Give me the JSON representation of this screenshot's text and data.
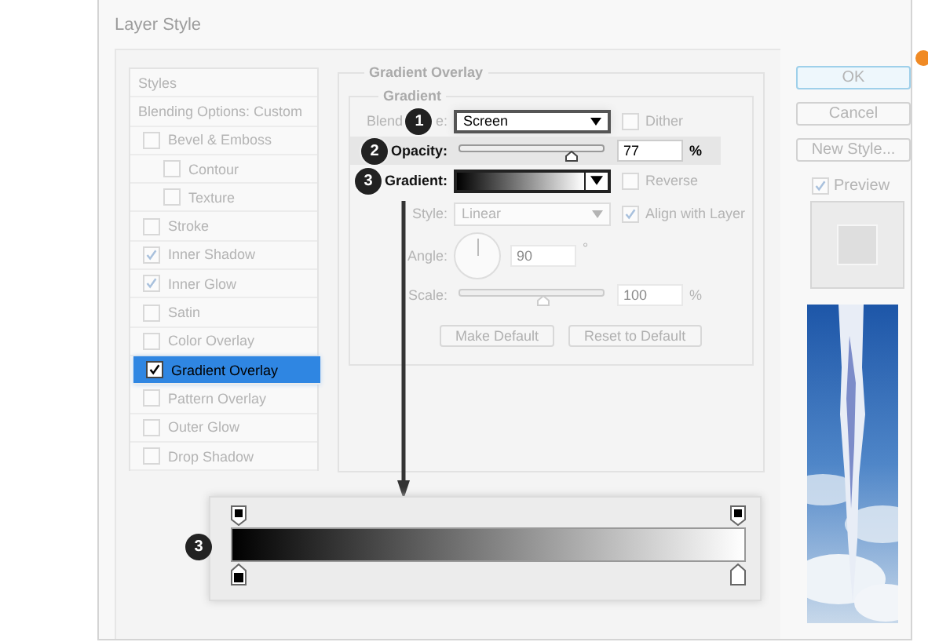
{
  "window": {
    "title": "Layer Style"
  },
  "styles_list": {
    "items": [
      {
        "label": "Styles",
        "kind": "header",
        "selected": false
      },
      {
        "label": "Blending Options: Custom",
        "kind": "plain",
        "selected": false
      },
      {
        "label": "Bevel & Emboss",
        "kind": "check",
        "checked": false,
        "selected": false
      },
      {
        "label": "Contour",
        "kind": "subcheck",
        "checked": false,
        "selected": false
      },
      {
        "label": "Texture",
        "kind": "subcheck",
        "checked": false,
        "selected": false
      },
      {
        "label": "Stroke",
        "kind": "check",
        "checked": false,
        "selected": false
      },
      {
        "label": "Inner Shadow",
        "kind": "check",
        "checked": true,
        "selected": false
      },
      {
        "label": "Inner Glow",
        "kind": "check",
        "checked": true,
        "selected": false
      },
      {
        "label": "Satin",
        "kind": "check",
        "checked": false,
        "selected": false
      },
      {
        "label": "Color Overlay",
        "kind": "check",
        "checked": false,
        "selected": false
      },
      {
        "label": "Gradient Overlay",
        "kind": "check",
        "checked": true,
        "selected": true
      },
      {
        "label": "Pattern Overlay",
        "kind": "check",
        "checked": false,
        "selected": false
      },
      {
        "label": "Outer Glow",
        "kind": "check",
        "checked": false,
        "selected": false
      },
      {
        "label": "Drop Shadow",
        "kind": "check",
        "checked": false,
        "selected": false
      }
    ]
  },
  "gradient_overlay": {
    "title": "Gradient Overlay",
    "group_title": "Gradient",
    "blend_mode": {
      "label_parts": [
        "Blend",
        "e:"
      ],
      "value": "Screen",
      "callout": "1"
    },
    "dither": {
      "label": "Dither",
      "checked": false
    },
    "opacity": {
      "label": "Opacity:",
      "level": 0.77,
      "value": "77",
      "unit": "%",
      "callout": "2"
    },
    "gradient": {
      "label": "Gradient:",
      "callout": "3"
    },
    "reverse": {
      "label": "Reverse",
      "checked": false
    },
    "style": {
      "label": "Style:",
      "value": "Linear"
    },
    "align": {
      "label": "Align with Layer",
      "checked": true
    },
    "angle": {
      "label": "Angle:",
      "value": "90",
      "unit": "°"
    },
    "scale": {
      "label": "Scale:",
      "level": 0.58,
      "value": "100",
      "unit": "%"
    },
    "buttons": [
      "Make Default",
      "Reset to Default"
    ]
  },
  "side": {
    "buttons": [
      {
        "label": "OK",
        "kind": "default"
      },
      {
        "label": "Cancel",
        "kind": "normal"
      },
      {
        "label": "New Style...",
        "kind": "normal"
      }
    ],
    "preview": {
      "label": "Preview",
      "checked": true
    }
  },
  "gradient_editor": {
    "callout": "3",
    "opacity_stops": [
      {
        "color": "#000000"
      },
      {
        "color": "#000000"
      }
    ],
    "color_stops": [
      {
        "color": "#000000"
      },
      {
        "color": "#ffffff"
      }
    ]
  }
}
